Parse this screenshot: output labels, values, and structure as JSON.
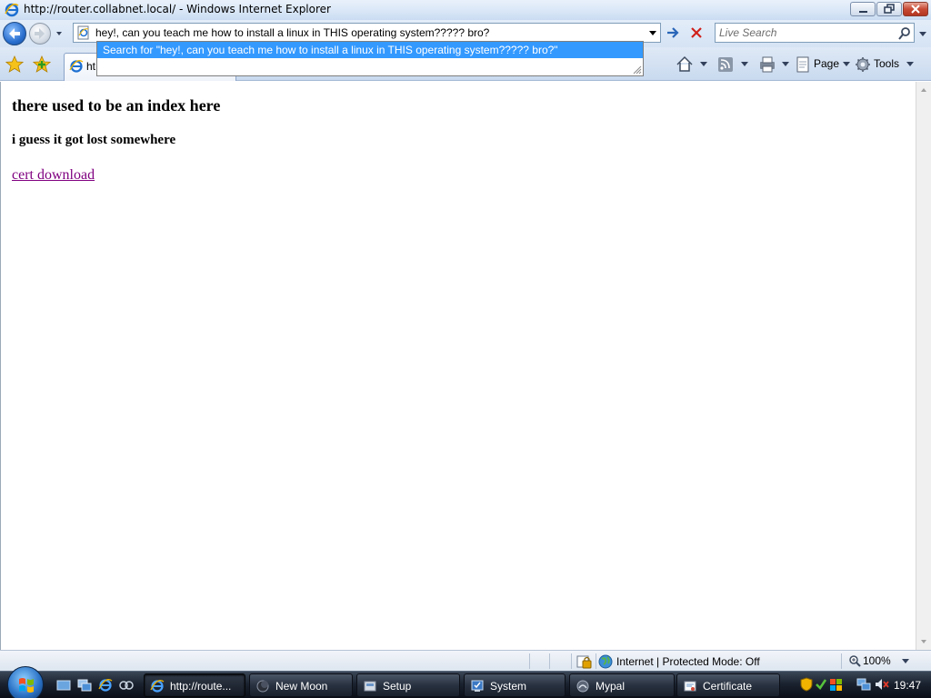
{
  "window": {
    "title": "http://router.collabnet.local/ - Windows Internet Explorer"
  },
  "address": {
    "value": "hey!, can you teach me how to install a linux in THIS operating system????? bro?"
  },
  "autocomplete": {
    "suggestion": "Search for \"hey!, can you teach me how to install a linux in THIS operating system????? bro?\""
  },
  "search": {
    "placeholder": "Live Search"
  },
  "tab": {
    "label": "ht"
  },
  "commandbar": {
    "page_label": "Page",
    "tools_label": "Tools"
  },
  "page": {
    "heading": "there used to be an index here",
    "subheading": "i guess it got lost somewhere",
    "link": "cert download"
  },
  "statusbar": {
    "zone": "Internet | Protected Mode: Off",
    "zoom": "100%"
  },
  "taskbar": {
    "tasks": [
      {
        "label": "http://route..."
      },
      {
        "label": "New Moon"
      },
      {
        "label": "Setup"
      },
      {
        "label": "System"
      },
      {
        "label": "Mypal"
      },
      {
        "label": "Certificate"
      }
    ],
    "clock": "19:47"
  },
  "colors": {
    "link_visited": "#800080",
    "autocomplete_highlight": "#3399ff",
    "close_button": "#c74a35"
  }
}
